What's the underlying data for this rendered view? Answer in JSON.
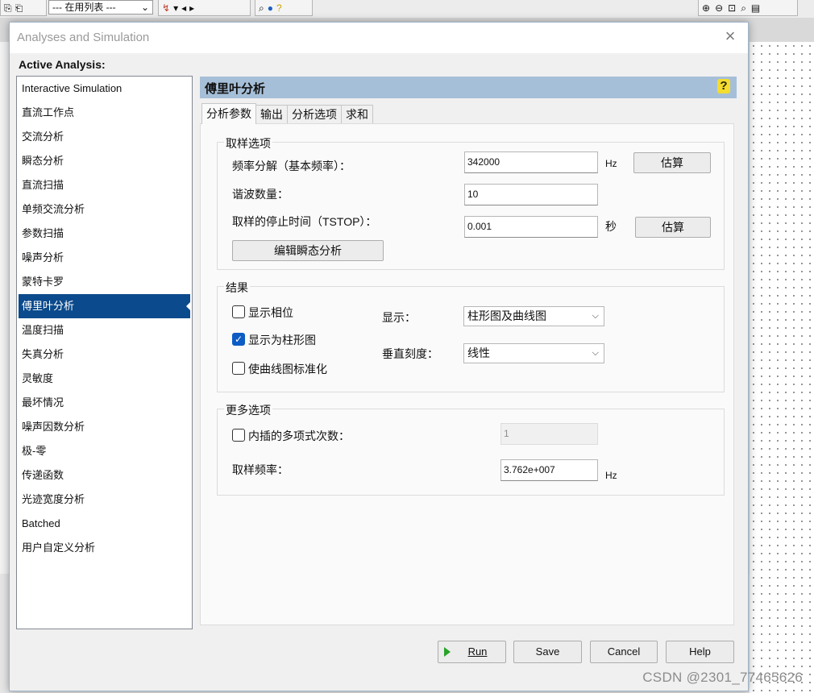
{
  "bg_app": {
    "toolbar_combo": "--- 在用列表 ---",
    "watermark": "CSDN @2301_77465626"
  },
  "dialog": {
    "title": "Analyses and Simulation",
    "active_analysis_label": "Active Analysis:",
    "analyses": [
      "Interactive Simulation",
      "直流工作点",
      "交流分析",
      "瞬态分析",
      "直流扫描",
      "单频交流分析",
      "参数扫描",
      "噪声分析",
      "蒙特卡罗",
      "傅里叶分析",
      "温度扫描",
      "失真分析",
      "灵敏度",
      "最坏情况",
      "噪声因数分析",
      "极-零",
      "传递函数",
      "光迹宽度分析",
      "Batched",
      "用户自定义分析"
    ],
    "selected_analysis": "傅里叶分析",
    "panel_title": "傅里叶分析",
    "help_symbol": "?",
    "tabs": [
      "分析参数",
      "输出",
      "分析选项",
      "求和"
    ],
    "sampling": {
      "legend": "取样选项",
      "freq_resolution_label": "频率分解（基本频率）：",
      "freq_resolution_value": "342000",
      "freq_unit": "Hz",
      "estimate_label": "估算",
      "harmonics_label": "谐波数量：",
      "harmonics_value": "10",
      "stop_time_label": "取样的停止时间（TSTOP）：",
      "stop_time_value": "0.001",
      "stop_time_unit": "秒",
      "estimate2_label": "估算",
      "edit_transient_label": "编辑瞬态分析"
    },
    "results": {
      "legend": "结果",
      "show_phase_label": "显示相位",
      "show_phase_checked": false,
      "show_bar_label": "显示为柱形图",
      "show_bar_checked": true,
      "normalize_label": "使曲线图标准化",
      "normalize_checked": false,
      "display_label": "显示：",
      "display_value": "柱形图及曲线图",
      "vscale_label": "垂直刻度：",
      "vscale_value": "线性"
    },
    "more": {
      "legend": "更多选项",
      "interp_label": "内插的多项式次数：",
      "interp_checked": false,
      "interp_value": "1",
      "sample_rate_label": "取样频率：",
      "sample_rate_value": "3.762e+007",
      "sample_rate_unit": "Hz"
    },
    "buttons": {
      "run": "Run",
      "save": "Save",
      "cancel": "Cancel",
      "help": "Help"
    },
    "colors": {
      "selection": "#0b4a8c",
      "panel_header": "#a6bfd8",
      "checkbox_checked": "#0c5cc4",
      "run_arrow": "#27a327"
    }
  }
}
